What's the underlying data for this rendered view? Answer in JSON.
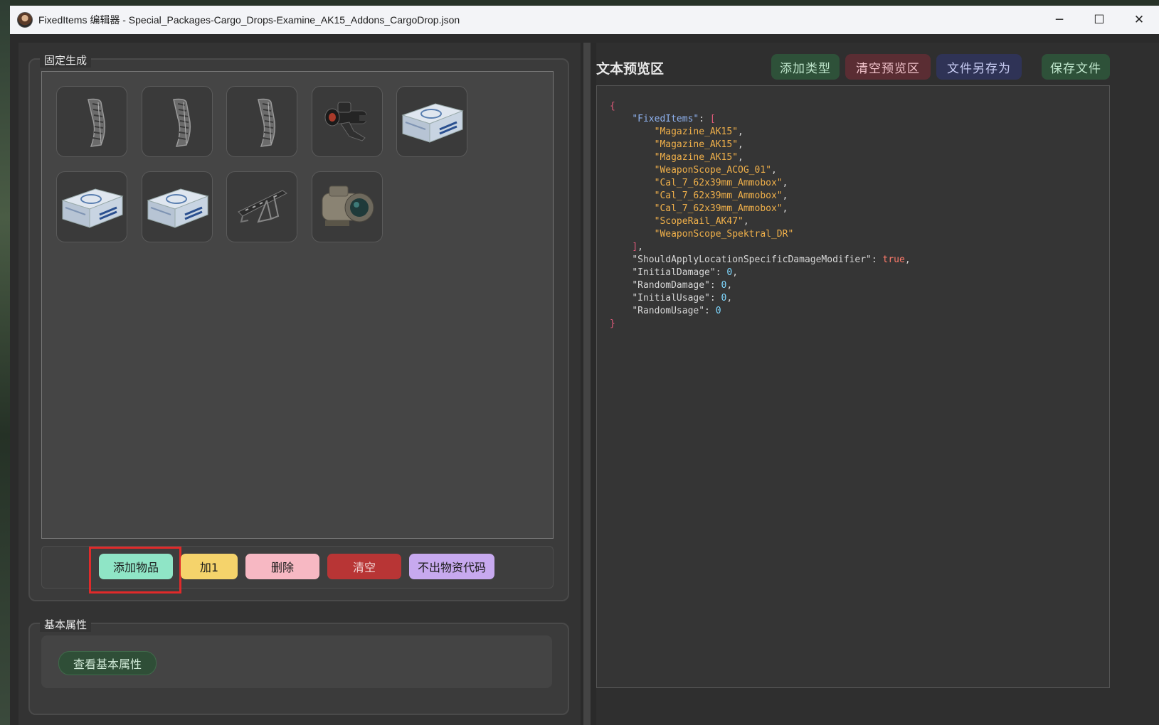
{
  "window": {
    "title": "FixedItems 编辑器 - Special_Packages-Cargo_Drops-Examine_AK15_Addons_CargoDrop.json",
    "controls": {
      "minimize": "─",
      "maximize": "☐",
      "close": "✕"
    }
  },
  "fixed_group": {
    "title": "固定生成",
    "items": [
      {
        "name": "Magazine_AK15",
        "icon": "magazine-icon"
      },
      {
        "name": "Magazine_AK15",
        "icon": "magazine-icon"
      },
      {
        "name": "Magazine_AK15",
        "icon": "magazine-icon"
      },
      {
        "name": "WeaponScope_ACOG_01",
        "icon": "acog-scope-icon"
      },
      {
        "name": "Cal_7_62x39mm_Ammobox",
        "icon": "ammobox-icon"
      },
      {
        "name": "Cal_7_62x39mm_Ammobox",
        "icon": "ammobox-icon"
      },
      {
        "name": "Cal_7_62x39mm_Ammobox",
        "icon": "ammobox-icon"
      },
      {
        "name": "ScopeRail_AK47",
        "icon": "scope-rail-icon"
      },
      {
        "name": "WeaponScope_Spektral_DR",
        "icon": "spektral-scope-icon"
      }
    ],
    "buttons": {
      "add_item": "添加物品",
      "plus_one": "加1",
      "delete": "删除",
      "clear": "清空",
      "no_code": "不出物资代码"
    }
  },
  "basic_group": {
    "title": "基本属性",
    "view_button": "查看基本属性"
  },
  "preview": {
    "title": "文本预览区",
    "buttons": {
      "add_type": "添加类型",
      "clear_preview": "清空预览区",
      "save_as": "文件另存为",
      "save": "保存文件"
    },
    "json": {
      "fixed_items_key": "FixedItems",
      "fixed_items": [
        "Magazine_AK15",
        "Magazine_AK15",
        "Magazine_AK15",
        "WeaponScope_ACOG_01",
        "Cal_7_62x39mm_Ammobox",
        "Cal_7_62x39mm_Ammobox",
        "Cal_7_62x39mm_Ammobox",
        "ScopeRail_AK47",
        "WeaponScope_Spektral_DR"
      ],
      "props": [
        {
          "key": "ShouldApplyLocationSpecificDamageModifier",
          "value": "true",
          "kind": "bool"
        },
        {
          "key": "InitialDamage",
          "value": "0",
          "kind": "num"
        },
        {
          "key": "RandomDamage",
          "value": "0",
          "kind": "num"
        },
        {
          "key": "InitialUsage",
          "value": "0",
          "kind": "num"
        },
        {
          "key": "RandomUsage",
          "value": "0",
          "kind": "num"
        }
      ]
    }
  },
  "colors": {
    "add_item": "#8fe5c6",
    "plus_one": "#f5d36b",
    "delete": "#f7b8c3",
    "clear": "#b83535",
    "no_code": "#c7a9ef",
    "highlight": "#e02a2a"
  }
}
